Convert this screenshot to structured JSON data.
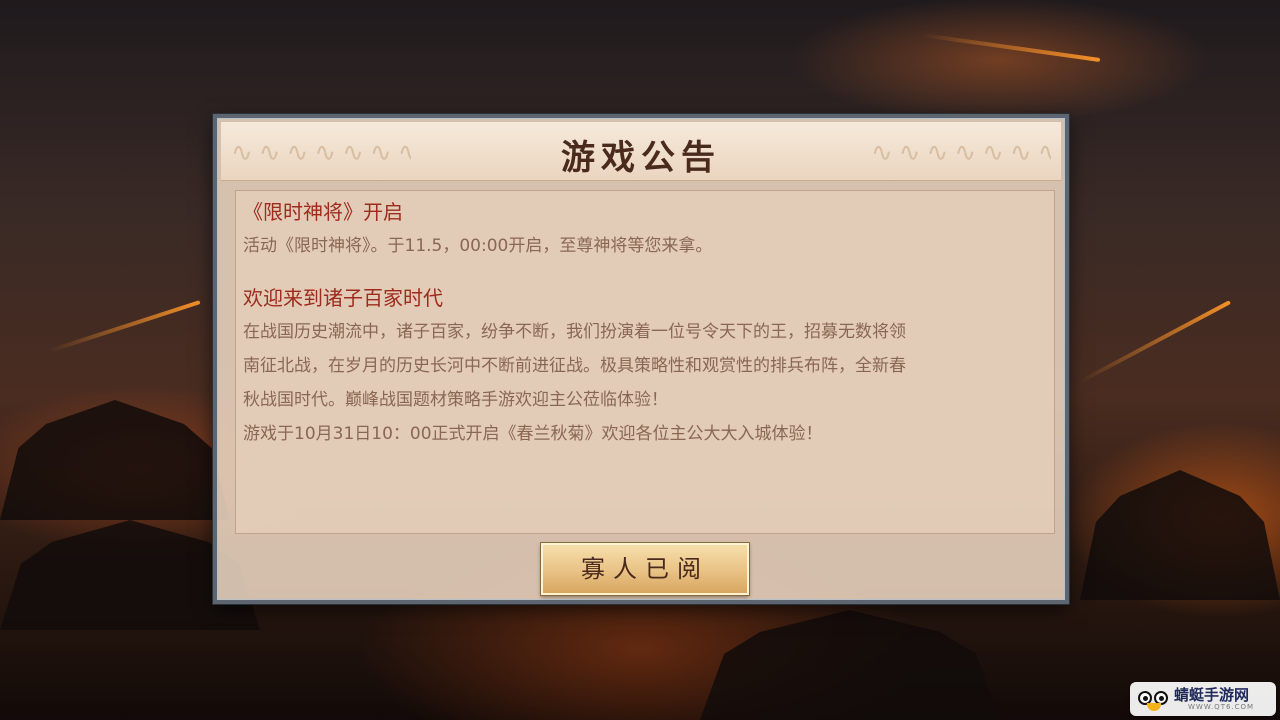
{
  "dialog": {
    "title": "游戏公告",
    "sections": [
      {
        "title": "《限时神将》开启",
        "body": [
          "活动《限时神将》。于11.5，00:00开启，至尊神将等您来拿。"
        ]
      },
      {
        "title": "欢迎来到诸子百家时代",
        "body": [
          "在战国历史潮流中，诸子百家，纷争不断，我们扮演着一位号令天下的王，招募无数将领",
          "南征北战，在岁月的历史长河中不断前进征战。极具策略性和观赏性的排兵布阵，全新春",
          "秋战国时代。巅峰战国题材策略手游欢迎主公莅临体验！",
          "游戏于10月31日10：00正式开启《春兰秋菊》欢迎各位主公大大入城体验！"
        ]
      }
    ],
    "ack_button_label": "寡人已阅"
  },
  "watermark": {
    "name": "蜻蜓手游网",
    "url": "WWW.QT6.COM",
    "icon": "dragonfly-mascot-icon"
  },
  "colors": {
    "section_title": "#9e2b1c",
    "body_text": "#8a6754",
    "title_text": "#4a2a1c",
    "button_gold": "#e9c285"
  }
}
